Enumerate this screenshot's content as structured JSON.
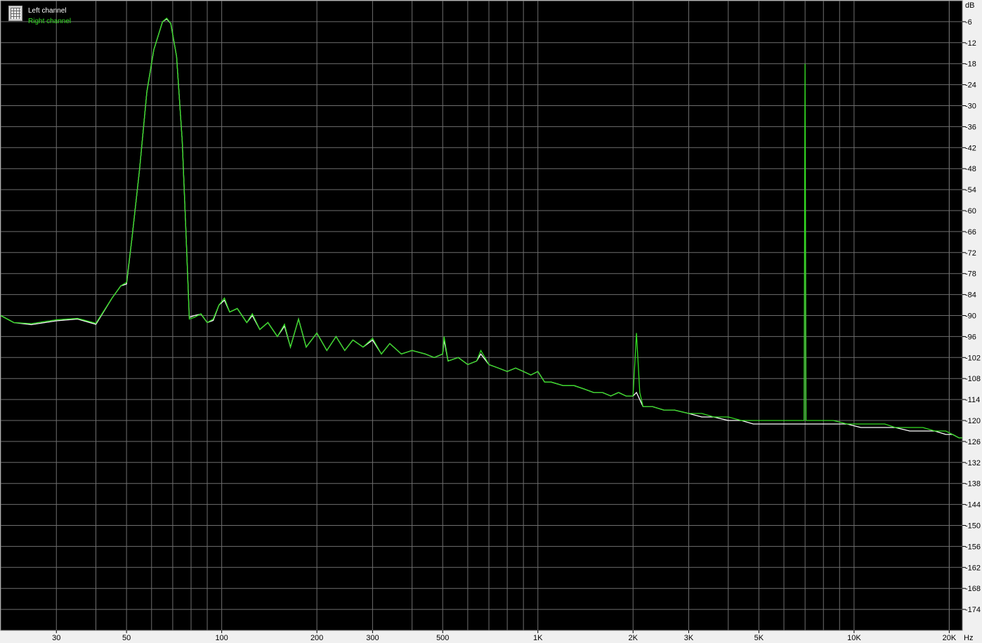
{
  "chart_data": {
    "type": "line",
    "x_scale": "log",
    "xlim": [
      20,
      22000
    ],
    "ylim": [
      -180,
      0
    ],
    "y_unit_label": "dB",
    "x_unit_label": "Hz",
    "grid": true,
    "legend_placement": "top-left",
    "colors": {
      "background": "#000000",
      "grid": "#6e6e6e",
      "left_channel": "#ffffff",
      "right_channel": "#33dd22",
      "panel": "#f0f0f0"
    },
    "x_ticks": [
      {
        "value": 30,
        "label": "30"
      },
      {
        "value": 50,
        "label": "50"
      },
      {
        "value": 100,
        "label": "100"
      },
      {
        "value": 200,
        "label": "200"
      },
      {
        "value": 300,
        "label": "300"
      },
      {
        "value": 500,
        "label": "500"
      },
      {
        "value": 1000,
        "label": "1K"
      },
      {
        "value": 2000,
        "label": "2K"
      },
      {
        "value": 3000,
        "label": "3K"
      },
      {
        "value": 5000,
        "label": "5K"
      },
      {
        "value": 10000,
        "label": "10K"
      },
      {
        "value": 20000,
        "label": "20K"
      }
    ],
    "y_ticks": [
      {
        "value": -6,
        "label": "-6"
      },
      {
        "value": -12,
        "label": "-12"
      },
      {
        "value": -18,
        "label": "-18"
      },
      {
        "value": -24,
        "label": "-24"
      },
      {
        "value": -30,
        "label": "-30"
      },
      {
        "value": -36,
        "label": "-36"
      },
      {
        "value": -42,
        "label": "-42"
      },
      {
        "value": -48,
        "label": "-48"
      },
      {
        "value": -54,
        "label": "-54"
      },
      {
        "value": -60,
        "label": "-60"
      },
      {
        "value": -66,
        "label": "-66"
      },
      {
        "value": -72,
        "label": "-72"
      },
      {
        "value": -78,
        "label": "-78"
      },
      {
        "value": -84,
        "label": "-84"
      },
      {
        "value": -90,
        "label": "-90"
      },
      {
        "value": -96,
        "label": "-96"
      },
      {
        "value": -102,
        "label": "-102"
      },
      {
        "value": -108,
        "label": "-108"
      },
      {
        "value": -114,
        "label": "-114"
      },
      {
        "value": -120,
        "label": "-120"
      },
      {
        "value": -126,
        "label": "-126"
      },
      {
        "value": -132,
        "label": "-132"
      },
      {
        "value": -138,
        "label": "-138"
      },
      {
        "value": -144,
        "label": "-144"
      },
      {
        "value": -150,
        "label": "-150"
      },
      {
        "value": -156,
        "label": "-156"
      },
      {
        "value": -162,
        "label": "-162"
      },
      {
        "value": -168,
        "label": "-168"
      },
      {
        "value": -174,
        "label": "-174"
      }
    ],
    "series": [
      {
        "name": "Left channel",
        "color": "#ffffff",
        "points": [
          [
            20,
            -90
          ],
          [
            22,
            -92
          ],
          [
            25,
            -92.6
          ],
          [
            30,
            -91.5
          ],
          [
            35,
            -91
          ],
          [
            40,
            -92.5
          ],
          [
            45,
            -85
          ],
          [
            48,
            -81.5
          ],
          [
            50,
            -81
          ],
          [
            52,
            -68
          ],
          [
            55,
            -48
          ],
          [
            58,
            -26
          ],
          [
            61,
            -14
          ],
          [
            65,
            -6
          ],
          [
            67,
            -5.2
          ],
          [
            69,
            -6.5
          ],
          [
            72,
            -16
          ],
          [
            75,
            -40
          ],
          [
            77,
            -65
          ],
          [
            79,
            -90.5
          ],
          [
            82,
            -90
          ],
          [
            86,
            -89.6
          ],
          [
            90,
            -92
          ],
          [
            94,
            -91.4
          ],
          [
            98,
            -87
          ],
          [
            102,
            -85.6
          ],
          [
            106,
            -89
          ],
          [
            112,
            -88
          ],
          [
            120,
            -92
          ],
          [
            125,
            -90
          ],
          [
            132,
            -94
          ],
          [
            140,
            -92
          ],
          [
            150,
            -96
          ],
          [
            158,
            -93
          ],
          [
            165,
            -99
          ],
          [
            175,
            -91
          ],
          [
            185,
            -99
          ],
          [
            200,
            -95
          ],
          [
            215,
            -100
          ],
          [
            230,
            -96
          ],
          [
            245,
            -100
          ],
          [
            260,
            -97
          ],
          [
            280,
            -99
          ],
          [
            300,
            -97
          ],
          [
            320,
            -101
          ],
          [
            340,
            -98
          ],
          [
            370,
            -101
          ],
          [
            400,
            -100
          ],
          [
            440,
            -101
          ],
          [
            470,
            -102
          ],
          [
            500,
            -101
          ],
          [
            505,
            -97
          ],
          [
            520,
            -103
          ],
          [
            560,
            -102
          ],
          [
            600,
            -104
          ],
          [
            640,
            -103
          ],
          [
            660,
            -101
          ],
          [
            700,
            -104
          ],
          [
            750,
            -105
          ],
          [
            800,
            -106
          ],
          [
            850,
            -105
          ],
          [
            900,
            -106
          ],
          [
            950,
            -107
          ],
          [
            1000,
            -106
          ],
          [
            1050,
            -109
          ],
          [
            1100,
            -109
          ],
          [
            1200,
            -110
          ],
          [
            1300,
            -110
          ],
          [
            1400,
            -111
          ],
          [
            1500,
            -112
          ],
          [
            1600,
            -112
          ],
          [
            1700,
            -113
          ],
          [
            1800,
            -112
          ],
          [
            1900,
            -113
          ],
          [
            2000,
            -113
          ],
          [
            2050,
            -112
          ],
          [
            2150,
            -116
          ],
          [
            2300,
            -116
          ],
          [
            2500,
            -117
          ],
          [
            2700,
            -117
          ],
          [
            3000,
            -118
          ],
          [
            3300,
            -119
          ],
          [
            3600,
            -119
          ],
          [
            4000,
            -120
          ],
          [
            4400,
            -120
          ],
          [
            4800,
            -121
          ],
          [
            5200,
            -121
          ],
          [
            5800,
            -121
          ],
          [
            6400,
            -121
          ],
          [
            7000,
            -121
          ],
          [
            7800,
            -121
          ],
          [
            8600,
            -121
          ],
          [
            9500,
            -121
          ],
          [
            10500,
            -122
          ],
          [
            11500,
            -122
          ],
          [
            12500,
            -122
          ],
          [
            13500,
            -122
          ],
          [
            15000,
            -123
          ],
          [
            16500,
            -123
          ],
          [
            18000,
            -123
          ],
          [
            19500,
            -124
          ],
          [
            20500,
            -124
          ],
          [
            21500,
            -125
          ],
          [
            22000,
            -125
          ]
        ]
      },
      {
        "name": "Right channel",
        "color": "#33dd22",
        "points": [
          [
            20,
            -90
          ],
          [
            22,
            -92
          ],
          [
            25,
            -92.3
          ],
          [
            30,
            -91.2
          ],
          [
            35,
            -90.8
          ],
          [
            40,
            -92.2
          ],
          [
            45,
            -85
          ],
          [
            48,
            -81.5
          ],
          [
            50,
            -80.5
          ],
          [
            52,
            -68
          ],
          [
            55,
            -48
          ],
          [
            58,
            -26
          ],
          [
            61,
            -14
          ],
          [
            65,
            -6
          ],
          [
            67,
            -5
          ],
          [
            69,
            -6.5
          ],
          [
            72,
            -16
          ],
          [
            75,
            -40
          ],
          [
            77,
            -65
          ],
          [
            79,
            -91
          ],
          [
            82,
            -90.5
          ],
          [
            86,
            -89.5
          ],
          [
            90,
            -92
          ],
          [
            94,
            -91
          ],
          [
            98,
            -87
          ],
          [
            102,
            -85
          ],
          [
            106,
            -89
          ],
          [
            112,
            -88
          ],
          [
            120,
            -92
          ],
          [
            125,
            -89.5
          ],
          [
            132,
            -94
          ],
          [
            140,
            -92
          ],
          [
            150,
            -96
          ],
          [
            158,
            -92.5
          ],
          [
            165,
            -99
          ],
          [
            175,
            -91
          ],
          [
            185,
            -99
          ],
          [
            200,
            -95
          ],
          [
            215,
            -100
          ],
          [
            230,
            -96
          ],
          [
            245,
            -100
          ],
          [
            260,
            -97
          ],
          [
            280,
            -99
          ],
          [
            300,
            -96.5
          ],
          [
            320,
            -101
          ],
          [
            340,
            -98
          ],
          [
            370,
            -101
          ],
          [
            400,
            -100
          ],
          [
            440,
            -101
          ],
          [
            470,
            -102
          ],
          [
            500,
            -101
          ],
          [
            505,
            -96
          ],
          [
            520,
            -103
          ],
          [
            560,
            -102
          ],
          [
            600,
            -104
          ],
          [
            640,
            -103
          ],
          [
            660,
            -100
          ],
          [
            700,
            -104
          ],
          [
            750,
            -105
          ],
          [
            800,
            -106
          ],
          [
            850,
            -105
          ],
          [
            900,
            -106
          ],
          [
            950,
            -107
          ],
          [
            1000,
            -106
          ],
          [
            1050,
            -109
          ],
          [
            1100,
            -109
          ],
          [
            1200,
            -110
          ],
          [
            1300,
            -110
          ],
          [
            1400,
            -111
          ],
          [
            1500,
            -112
          ],
          [
            1600,
            -112
          ],
          [
            1700,
            -113
          ],
          [
            1800,
            -112
          ],
          [
            1900,
            -113
          ],
          [
            2000,
            -113
          ],
          [
            2050,
            -95
          ],
          [
            2100,
            -112
          ],
          [
            2150,
            -116
          ],
          [
            2300,
            -116
          ],
          [
            2500,
            -117
          ],
          [
            2700,
            -117
          ],
          [
            3000,
            -118
          ],
          [
            3300,
            -118
          ],
          [
            3600,
            -119
          ],
          [
            4000,
            -119
          ],
          [
            4400,
            -120
          ],
          [
            4800,
            -120
          ],
          [
            5200,
            -120
          ],
          [
            5800,
            -120
          ],
          [
            6400,
            -120
          ],
          [
            6950,
            -120
          ],
          [
            7000,
            -18
          ],
          [
            7050,
            -120
          ],
          [
            7800,
            -120
          ],
          [
            8600,
            -120
          ],
          [
            9500,
            -121
          ],
          [
            10500,
            -121
          ],
          [
            11500,
            -121
          ],
          [
            12500,
            -121
          ],
          [
            13500,
            -122
          ],
          [
            15000,
            -122
          ],
          [
            16500,
            -122
          ],
          [
            18000,
            -123
          ],
          [
            19500,
            -123
          ],
          [
            20500,
            -124
          ],
          [
            21500,
            -125
          ],
          [
            22000,
            -125
          ]
        ]
      }
    ]
  }
}
